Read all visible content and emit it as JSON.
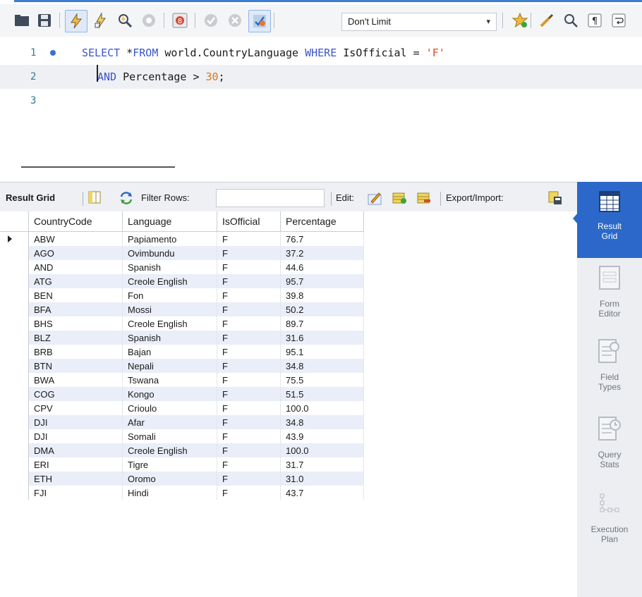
{
  "toolbar": {
    "limit_select": {
      "value": "Don't Limit"
    },
    "icons": [
      "folder-icon",
      "save-icon",
      "execute-icon",
      "execute-current-icon",
      "explain-icon",
      "stop-icon",
      "toggle-error-icon",
      "commit-icon",
      "rollback-icon",
      "autocommit-icon",
      "bookmark-icon",
      "beautify-icon",
      "find-icon",
      "invisible-chars-icon",
      "wrap-icon"
    ]
  },
  "editor": {
    "lines": [
      {
        "number": "1"
      },
      {
        "number": "2"
      },
      {
        "number": "3"
      }
    ],
    "line1": {
      "kw_select": "SELECT",
      "text1": " *",
      "kw_from": "FROM",
      "text2": " world.CountryLanguage ",
      "kw_where": "WHERE",
      "text3": " IsOfficial = ",
      "str": "'F'"
    },
    "line2": {
      "kw_and": "AND",
      "text1": " Percentage > ",
      "num": "30",
      "text2": ";"
    }
  },
  "result_toolbar": {
    "result_grid_label": "Result Grid",
    "filter_label": "Filter Rows:",
    "filter_value": "",
    "edit_label": "Edit:",
    "export_label": "Export/Import:"
  },
  "grid": {
    "columns": [
      "CountryCode",
      "Language",
      "IsOfficial",
      "Percentage"
    ],
    "rows": [
      [
        "ABW",
        "Papiamento",
        "F",
        "76.7"
      ],
      [
        "AGO",
        "Ovimbundu",
        "F",
        "37.2"
      ],
      [
        "AND",
        "Spanish",
        "F",
        "44.6"
      ],
      [
        "ATG",
        "Creole English",
        "F",
        "95.7"
      ],
      [
        "BEN",
        "Fon",
        "F",
        "39.8"
      ],
      [
        "BFA",
        "Mossi",
        "F",
        "50.2"
      ],
      [
        "BHS",
        "Creole English",
        "F",
        "89.7"
      ],
      [
        "BLZ",
        "Spanish",
        "F",
        "31.6"
      ],
      [
        "BRB",
        "Bajan",
        "F",
        "95.1"
      ],
      [
        "BTN",
        "Nepali",
        "F",
        "34.8"
      ],
      [
        "BWA",
        "Tswana",
        "F",
        "75.5"
      ],
      [
        "COG",
        "Kongo",
        "F",
        "51.5"
      ],
      [
        "CPV",
        "Crioulo",
        "F",
        "100.0"
      ],
      [
        "DJI",
        "Afar",
        "F",
        "34.8"
      ],
      [
        "DJI",
        "Somali",
        "F",
        "43.9"
      ],
      [
        "DMA",
        "Creole English",
        "F",
        "100.0"
      ],
      [
        "ERI",
        "Tigre",
        "F",
        "31.7"
      ],
      [
        "ETH",
        "Oromo",
        "F",
        "31.0"
      ],
      [
        "FJI",
        "Hindi",
        "F",
        "43.7"
      ]
    ]
  },
  "side_panel": {
    "items": [
      {
        "label_line1": "Result",
        "label_line2": "Grid",
        "active": true
      },
      {
        "label_line1": "Form",
        "label_line2": "Editor",
        "active": false
      },
      {
        "label_line1": "Field",
        "label_line2": "Types",
        "active": false
      },
      {
        "label_line1": "Query",
        "label_line2": "Stats",
        "active": false
      },
      {
        "label_line1": "Execution",
        "label_line2": "Plan",
        "active": false
      }
    ]
  },
  "colors": {
    "accent": "#2b68c9",
    "keyword": "#3b55c9",
    "number": "#d17a1e",
    "string": "#d14f27",
    "row_alt": "#e9eef8"
  }
}
